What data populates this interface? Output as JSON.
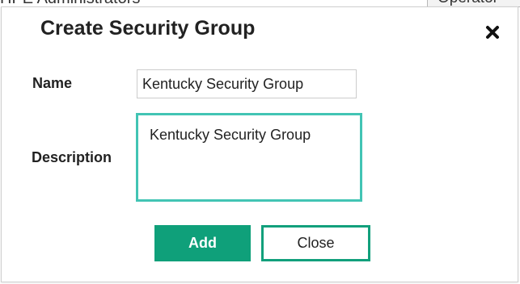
{
  "background": {
    "left_header_text": "HPE Administrators",
    "right_tab_text": "Operator"
  },
  "dialog": {
    "title": "Create Security Group",
    "close_icon": "close-icon",
    "name_label": "Name",
    "name_value": "Kentucky Security Group",
    "description_label": "Description",
    "description_value": "Kentucky Security Group",
    "add_label": "Add",
    "close_label": "Close"
  },
  "colors": {
    "accent": "#0fa07a",
    "focus_border": "#42c4b4"
  }
}
